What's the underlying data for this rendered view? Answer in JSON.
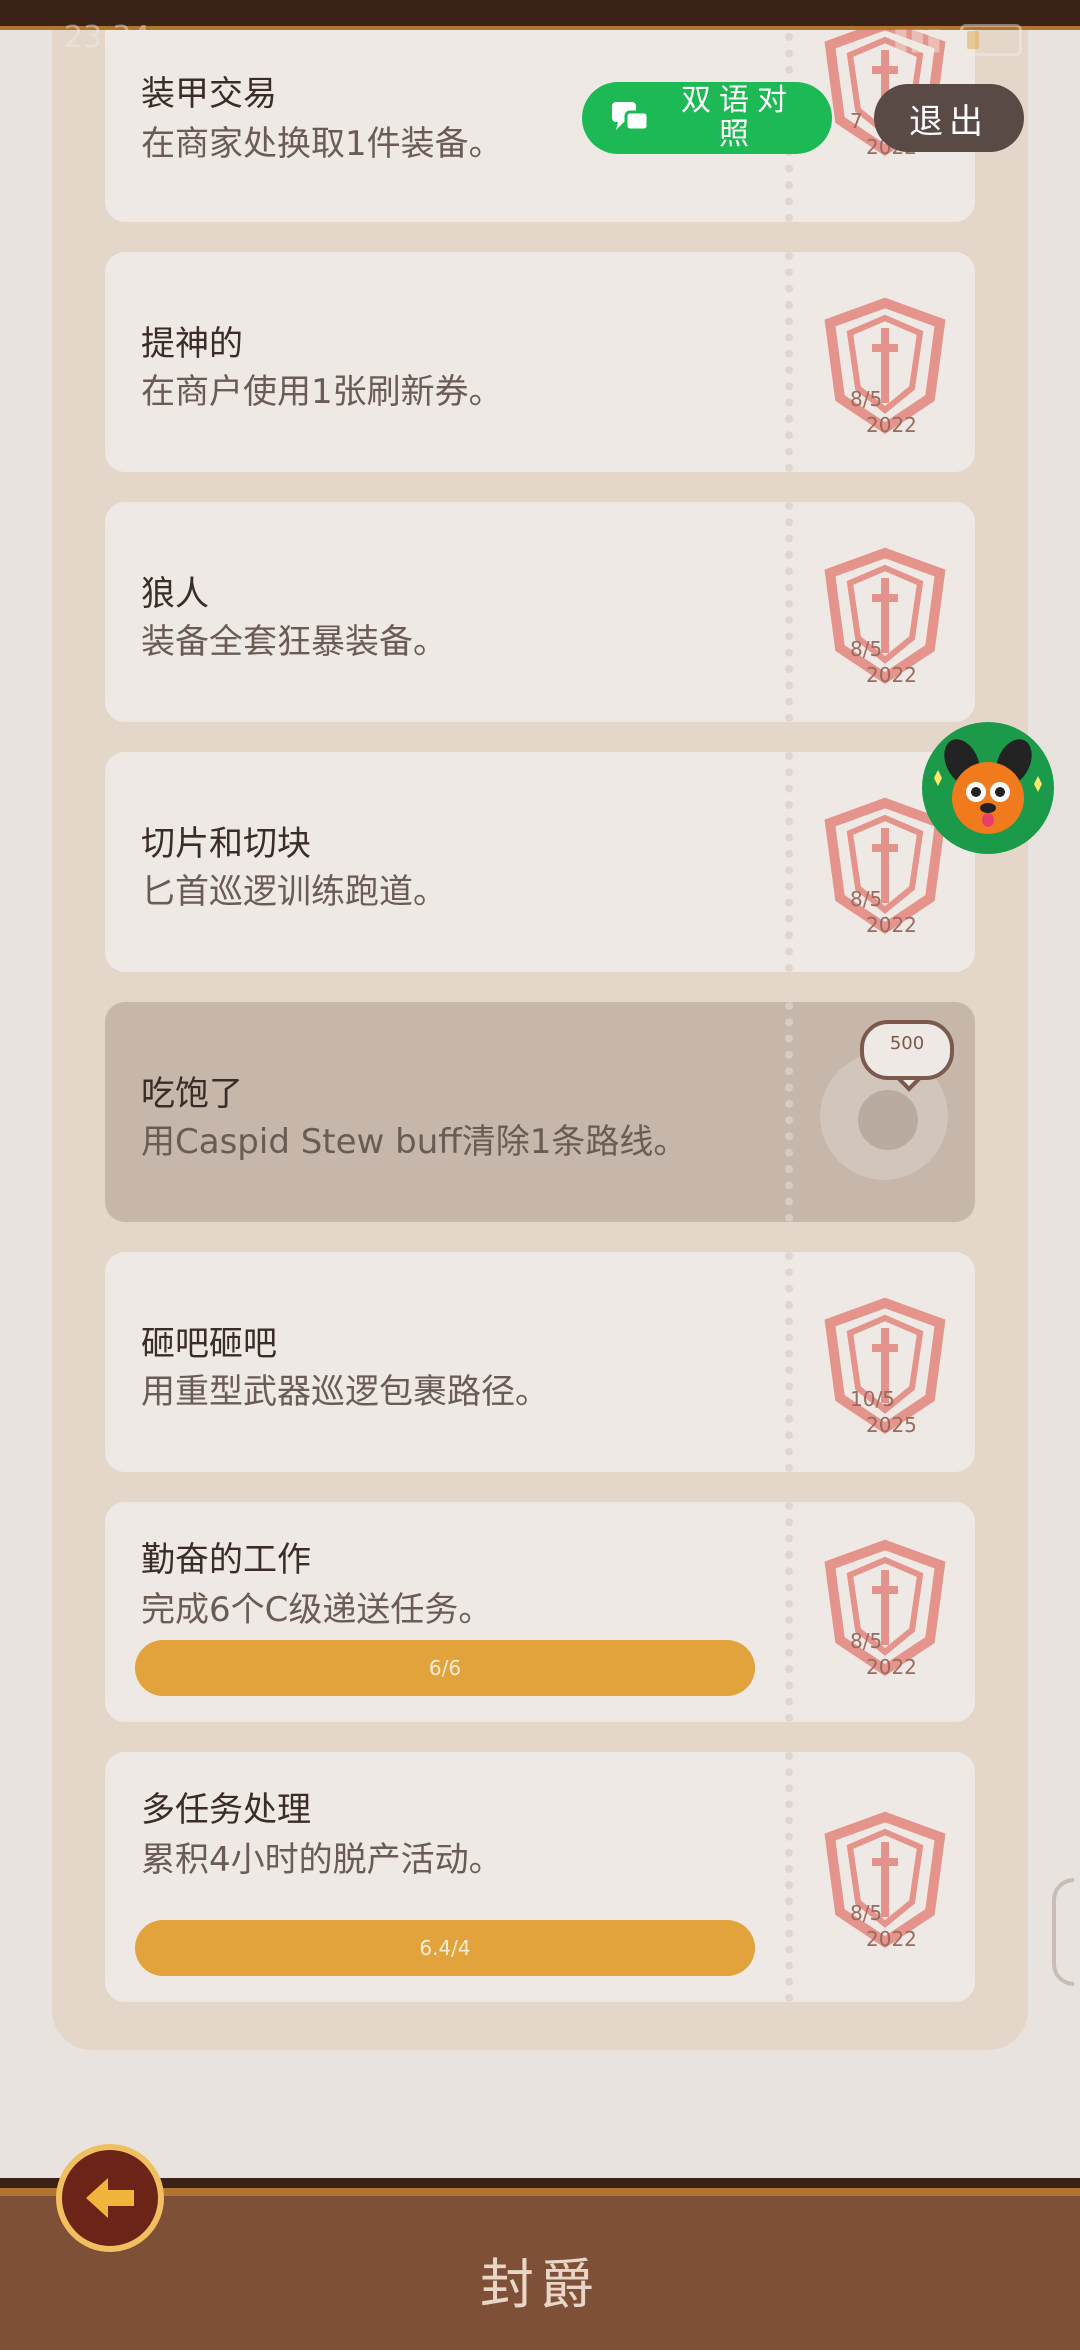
{
  "status_bar": {
    "time": "23:34"
  },
  "header": {
    "bilingual_label": "双语对照",
    "exit_label": "退出"
  },
  "achievements": [
    {
      "title": "装甲交易",
      "desc": "在商家处换取1件装备。",
      "date": "7",
      "year": "2022",
      "completed": true
    },
    {
      "title": "提神的",
      "desc": "在商户使用1张刷新券。",
      "date": "8/5",
      "year": "2022",
      "completed": true
    },
    {
      "title": "狼人",
      "desc": "装备全套狂暴装备。",
      "date": "8/5",
      "year": "2022",
      "completed": true
    },
    {
      "title": "切片和切块",
      "desc": "匕首巡逻训练跑道。",
      "date": "8/5",
      "year": "2022",
      "completed": true
    },
    {
      "title": "吃饱了",
      "desc": "用Caspid Stew buff清除1条路线。",
      "reward": "500",
      "completed": false
    },
    {
      "title": "砸吧砸吧",
      "desc": "用重型武器巡逻包裹路径。",
      "date": "10/5",
      "year": "2025",
      "completed": true
    },
    {
      "title": "勤奋的工作",
      "desc": "完成6个C级递送任务。",
      "progress": "6/6",
      "date": "8/5",
      "year": "2022",
      "completed": true
    },
    {
      "title": "多任务处理",
      "desc": "累积4小时的脱产活动。",
      "progress": "6.4/4",
      "date": "8/5",
      "year": "2022",
      "completed": true
    }
  ],
  "footer": {
    "title": "封爵"
  },
  "colors": {
    "accent_green": "#1db954",
    "progress_orange": "#e2a33c",
    "stamp_red": "#e0776c",
    "bar_brown": "#7e5038"
  },
  "icons": {
    "bilingual": "chat-bubbles-icon",
    "back": "arrow-left-icon",
    "stamp": "seal-stamp-icon"
  }
}
